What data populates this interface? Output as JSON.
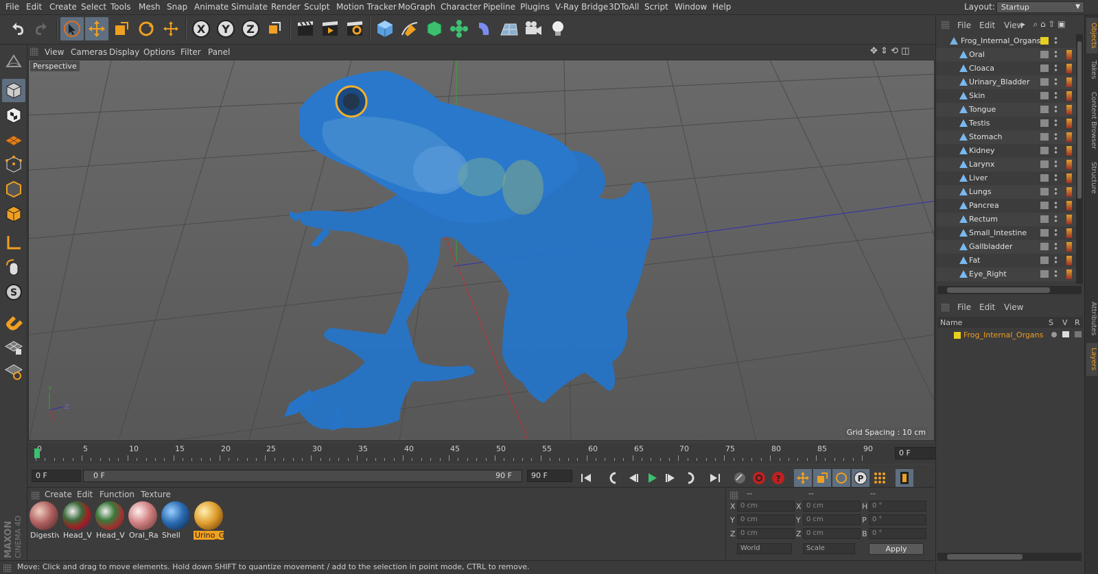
{
  "menu": [
    "File",
    "Edit",
    "Create",
    "Select",
    "Tools",
    "Mesh",
    "Snap",
    "Animate",
    "Simulate",
    "Render",
    "Sculpt",
    "Motion Tracker",
    "MoGraph",
    "Character",
    "Pipeline",
    "Plugins",
    "V-Ray Bridge",
    "3DToAll",
    "Script",
    "Window",
    "Help"
  ],
  "layout": {
    "label": "Layout:",
    "value": "Startup"
  },
  "viewport": {
    "menu": [
      "View",
      "Cameras",
      "Display",
      "Options",
      "Filter",
      "Panel"
    ],
    "camera_label": "Perspective",
    "grid_spacing": "Grid Spacing : 10 cm"
  },
  "timeline": {
    "ticks": [
      "0",
      "5",
      "10",
      "15",
      "20",
      "25",
      "30",
      "35",
      "40",
      "45",
      "50",
      "55",
      "60",
      "65",
      "70",
      "75",
      "80",
      "85",
      "90"
    ],
    "current_frame": "0 F",
    "start_field": "0 F",
    "range_start": "0 F",
    "range_end": "90 F",
    "end_field": "90 F"
  },
  "materials": {
    "menu": [
      "Create",
      "Edit",
      "Function",
      "Texture"
    ],
    "items": [
      {
        "label": "Digestiv",
        "color": "#b06060"
      },
      {
        "label": "Head_Vi",
        "color": "#6a5a7a"
      },
      {
        "label": "Head_Vi",
        "color": "#607060"
      },
      {
        "label": "Oral_Ra",
        "color": "#d08080"
      },
      {
        "label": "Shell",
        "color": "#2a6ab0"
      },
      {
        "label": "Urino_G",
        "color": "#e0a030"
      }
    ]
  },
  "coords": {
    "headers": [
      "--",
      "--",
      "--"
    ],
    "rows": [
      {
        "a": "X",
        "av": "0 cm",
        "b": "X",
        "bv": "0 cm",
        "c": "H",
        "cv": "0 °"
      },
      {
        "a": "Y",
        "av": "0 cm",
        "b": "Y",
        "bv": "0 cm",
        "c": "P",
        "cv": "0 °"
      },
      {
        "a": "Z",
        "av": "0 cm",
        "b": "Z",
        "bv": "0 cm",
        "c": "B",
        "cv": "0 °"
      }
    ],
    "world": "World",
    "scale": "Scale",
    "apply": "Apply"
  },
  "status": "Move: Click and drag to move elements. Hold down SHIFT to quantize movement / add to the selection in point mode, CTRL to remove.",
  "objects": {
    "menu": [
      "File",
      "Edit",
      "View"
    ],
    "root": "Frog_Internal_Organs",
    "children": [
      "Oral",
      "Cloaca",
      "Urinary_Bladder",
      "Skin",
      "Tongue",
      "Testis",
      "Stomach",
      "Kidney",
      "Larynx",
      "Liver",
      "Lungs",
      "Pancrea",
      "Rectum",
      "Small_Intestine",
      "Gallbladder",
      "Fat",
      "Eye_Right"
    ]
  },
  "layers": {
    "menu": [
      "File",
      "Edit",
      "View"
    ],
    "columns": {
      "name": "Name",
      "s": "S",
      "v": "V",
      "r": "R"
    },
    "items": [
      "Frog_Internal_Organs"
    ]
  },
  "right_tabs": [
    "Objects",
    "Takes",
    "Content Browser",
    "Structure",
    "Attributes",
    "Layers"
  ],
  "brand": [
    "MAXON",
    "CINEMA 4D"
  ]
}
